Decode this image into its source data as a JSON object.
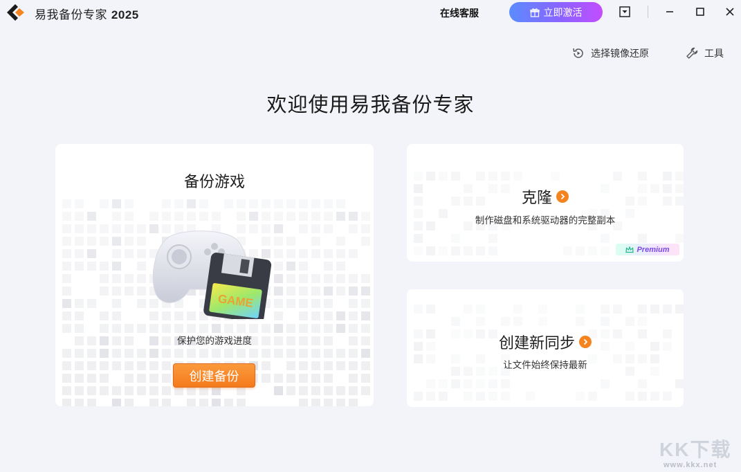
{
  "app": {
    "title": "易我备份专家",
    "year": "2025"
  },
  "titlebar": {
    "support_label": "在线客服",
    "activate_label": "立即激活"
  },
  "toolbar": {
    "restore_image_label": "选择镜像还原",
    "tools_label": "工具"
  },
  "main": {
    "welcome": "欢迎使用易我备份专家"
  },
  "cards": {
    "game": {
      "title": "备份游戏",
      "subtitle": "保护您的游戏进度",
      "button": "创建备份",
      "disk_label": "GAME"
    },
    "clone": {
      "title": "克隆",
      "subtitle": "制作磁盘和系统驱动器的完整副本",
      "badge": "Premium"
    },
    "sync": {
      "title": "创建新同步",
      "subtitle": "让文件始终保持最新"
    }
  },
  "watermark": {
    "text": "KK下载",
    "url": "www.kkx.net"
  },
  "colors": {
    "background": "#f3f4f9",
    "accent_orange": "#f5841f",
    "activate_gradient_start": "#5b8cff",
    "activate_gradient_end": "#c24dff"
  }
}
